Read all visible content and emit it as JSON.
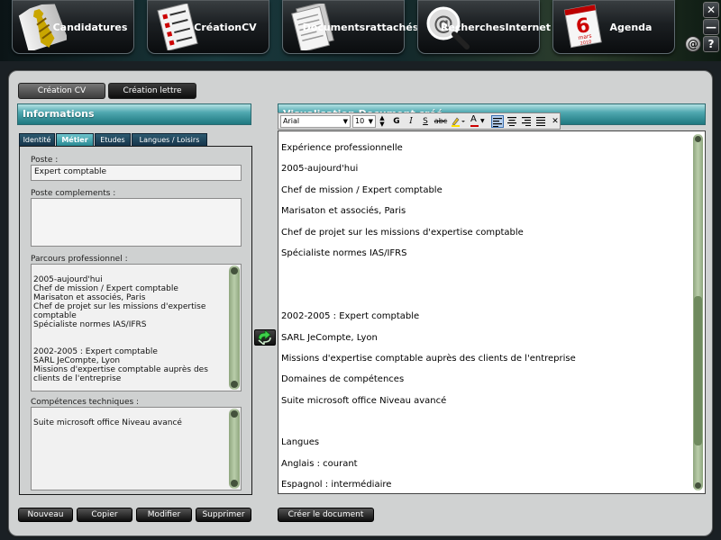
{
  "nav": {
    "candidatures": "Candidatures",
    "creation_cv_line1": "Création",
    "creation_cv_line2": "CV",
    "documents_line1": "Documents",
    "documents_line2": "rattachés",
    "recherches_line1": "Recherches",
    "recherches_line2": "Internet",
    "agenda": "Agenda",
    "calendar_day": "6",
    "calendar_month": "mars",
    "calendar_year": "2010"
  },
  "window": {
    "close_glyph": "✕",
    "minimize_glyph": "—",
    "help_glyph": "?",
    "at_glyph": "@"
  },
  "tabs": {
    "creation_cv": "Création CV",
    "creation_lettre": "Création lettre"
  },
  "left_panel": {
    "header": "Informations",
    "subtabs": [
      "Identité",
      "Métier",
      "Etudes",
      "Langues / Loisirs"
    ],
    "active_subtab": "Métier",
    "poste_label": "Poste :",
    "poste_value": "Expert comptable",
    "complements_label": "Poste complements :",
    "complements_value": "",
    "parcours_label": "Parcours professionnel :",
    "parcours_value": "2005-aujourd'hui\nChef de mission / Expert comptable\nMarisaton et associés, Paris\nChef de projet sur les missions d'expertise\ncomptable\nSpécialiste normes IAS/IFRS\n\n\n2002-2005 : Expert comptable\nSARL JeCompte, Lyon\nMissions d'expertise comptable auprès des\nclients de l'entreprise",
    "competences_label": "Compétences techniques :",
    "competences_value": "Suite microsoft office Niveau avancé"
  },
  "buttons": {
    "nouveau": "Nouveau",
    "copier": "Copier",
    "modifier": "Modifier",
    "supprimer": "Supprimer",
    "creer": "Créer le document"
  },
  "right_panel": {
    "header": "Visualisation Document créé",
    "font_family": "Arial",
    "font_size": "10",
    "bold": "G",
    "italic": "I",
    "underline": "S",
    "strike": "abc",
    "font_color": "A",
    "clear": "✕",
    "content": [
      "Expérience professionnelle",
      "2005-aujourd'hui",
      "Chef de mission / Expert comptable",
      "Marisaton et associés, Paris",
      "Chef de projet sur les missions d'expertise comptable",
      "Spécialiste normes IAS/IFRS",
      "",
      "",
      "2002-2005 : Expert comptable",
      "SARL JeCompte, Lyon",
      "Missions d'expertise comptable auprès des clients de l'entreprise",
      "Domaines de compétences",
      "Suite microsoft office Niveau avancé",
      "",
      "Langues",
      "Anglais : courant",
      "Espagnol : intermédiaire"
    ]
  },
  "colors": {
    "teal_header": "#2a8a94",
    "scroll_green": "#8fa67e",
    "panel_bg": "#d0d2d2"
  }
}
